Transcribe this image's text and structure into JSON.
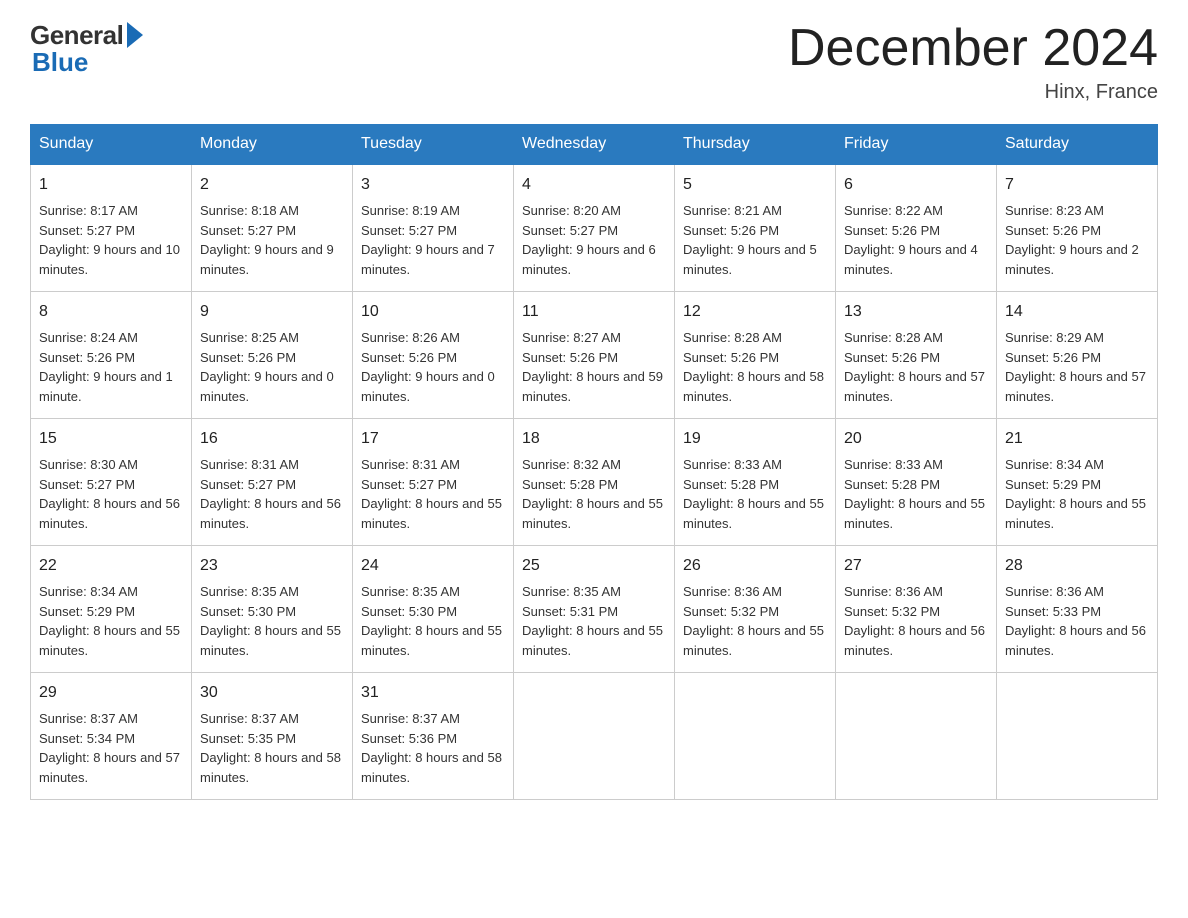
{
  "header": {
    "logo_general": "General",
    "logo_blue": "Blue",
    "title": "December 2024",
    "location": "Hinx, France"
  },
  "days_of_week": [
    "Sunday",
    "Monday",
    "Tuesday",
    "Wednesday",
    "Thursday",
    "Friday",
    "Saturday"
  ],
  "weeks": [
    [
      {
        "day": "1",
        "sunrise": "8:17 AM",
        "sunset": "5:27 PM",
        "daylight": "9 hours and 10 minutes."
      },
      {
        "day": "2",
        "sunrise": "8:18 AM",
        "sunset": "5:27 PM",
        "daylight": "9 hours and 9 minutes."
      },
      {
        "day": "3",
        "sunrise": "8:19 AM",
        "sunset": "5:27 PM",
        "daylight": "9 hours and 7 minutes."
      },
      {
        "day": "4",
        "sunrise": "8:20 AM",
        "sunset": "5:27 PM",
        "daylight": "9 hours and 6 minutes."
      },
      {
        "day": "5",
        "sunrise": "8:21 AM",
        "sunset": "5:26 PM",
        "daylight": "9 hours and 5 minutes."
      },
      {
        "day": "6",
        "sunrise": "8:22 AM",
        "sunset": "5:26 PM",
        "daylight": "9 hours and 4 minutes."
      },
      {
        "day": "7",
        "sunrise": "8:23 AM",
        "sunset": "5:26 PM",
        "daylight": "9 hours and 2 minutes."
      }
    ],
    [
      {
        "day": "8",
        "sunrise": "8:24 AM",
        "sunset": "5:26 PM",
        "daylight": "9 hours and 1 minute."
      },
      {
        "day": "9",
        "sunrise": "8:25 AM",
        "sunset": "5:26 PM",
        "daylight": "9 hours and 0 minutes."
      },
      {
        "day": "10",
        "sunrise": "8:26 AM",
        "sunset": "5:26 PM",
        "daylight": "9 hours and 0 minutes."
      },
      {
        "day": "11",
        "sunrise": "8:27 AM",
        "sunset": "5:26 PM",
        "daylight": "8 hours and 59 minutes."
      },
      {
        "day": "12",
        "sunrise": "8:28 AM",
        "sunset": "5:26 PM",
        "daylight": "8 hours and 58 minutes."
      },
      {
        "day": "13",
        "sunrise": "8:28 AM",
        "sunset": "5:26 PM",
        "daylight": "8 hours and 57 minutes."
      },
      {
        "day": "14",
        "sunrise": "8:29 AM",
        "sunset": "5:26 PM",
        "daylight": "8 hours and 57 minutes."
      }
    ],
    [
      {
        "day": "15",
        "sunrise": "8:30 AM",
        "sunset": "5:27 PM",
        "daylight": "8 hours and 56 minutes."
      },
      {
        "day": "16",
        "sunrise": "8:31 AM",
        "sunset": "5:27 PM",
        "daylight": "8 hours and 56 minutes."
      },
      {
        "day": "17",
        "sunrise": "8:31 AM",
        "sunset": "5:27 PM",
        "daylight": "8 hours and 55 minutes."
      },
      {
        "day": "18",
        "sunrise": "8:32 AM",
        "sunset": "5:28 PM",
        "daylight": "8 hours and 55 minutes."
      },
      {
        "day": "19",
        "sunrise": "8:33 AM",
        "sunset": "5:28 PM",
        "daylight": "8 hours and 55 minutes."
      },
      {
        "day": "20",
        "sunrise": "8:33 AM",
        "sunset": "5:28 PM",
        "daylight": "8 hours and 55 minutes."
      },
      {
        "day": "21",
        "sunrise": "8:34 AM",
        "sunset": "5:29 PM",
        "daylight": "8 hours and 55 minutes."
      }
    ],
    [
      {
        "day": "22",
        "sunrise": "8:34 AM",
        "sunset": "5:29 PM",
        "daylight": "8 hours and 55 minutes."
      },
      {
        "day": "23",
        "sunrise": "8:35 AM",
        "sunset": "5:30 PM",
        "daylight": "8 hours and 55 minutes."
      },
      {
        "day": "24",
        "sunrise": "8:35 AM",
        "sunset": "5:30 PM",
        "daylight": "8 hours and 55 minutes."
      },
      {
        "day": "25",
        "sunrise": "8:35 AM",
        "sunset": "5:31 PM",
        "daylight": "8 hours and 55 minutes."
      },
      {
        "day": "26",
        "sunrise": "8:36 AM",
        "sunset": "5:32 PM",
        "daylight": "8 hours and 55 minutes."
      },
      {
        "day": "27",
        "sunrise": "8:36 AM",
        "sunset": "5:32 PM",
        "daylight": "8 hours and 56 minutes."
      },
      {
        "day": "28",
        "sunrise": "8:36 AM",
        "sunset": "5:33 PM",
        "daylight": "8 hours and 56 minutes."
      }
    ],
    [
      {
        "day": "29",
        "sunrise": "8:37 AM",
        "sunset": "5:34 PM",
        "daylight": "8 hours and 57 minutes."
      },
      {
        "day": "30",
        "sunrise": "8:37 AM",
        "sunset": "5:35 PM",
        "daylight": "8 hours and 58 minutes."
      },
      {
        "day": "31",
        "sunrise": "8:37 AM",
        "sunset": "5:36 PM",
        "daylight": "8 hours and 58 minutes."
      },
      null,
      null,
      null,
      null
    ]
  ],
  "labels": {
    "sunrise": "Sunrise:",
    "sunset": "Sunset:",
    "daylight": "Daylight:"
  }
}
